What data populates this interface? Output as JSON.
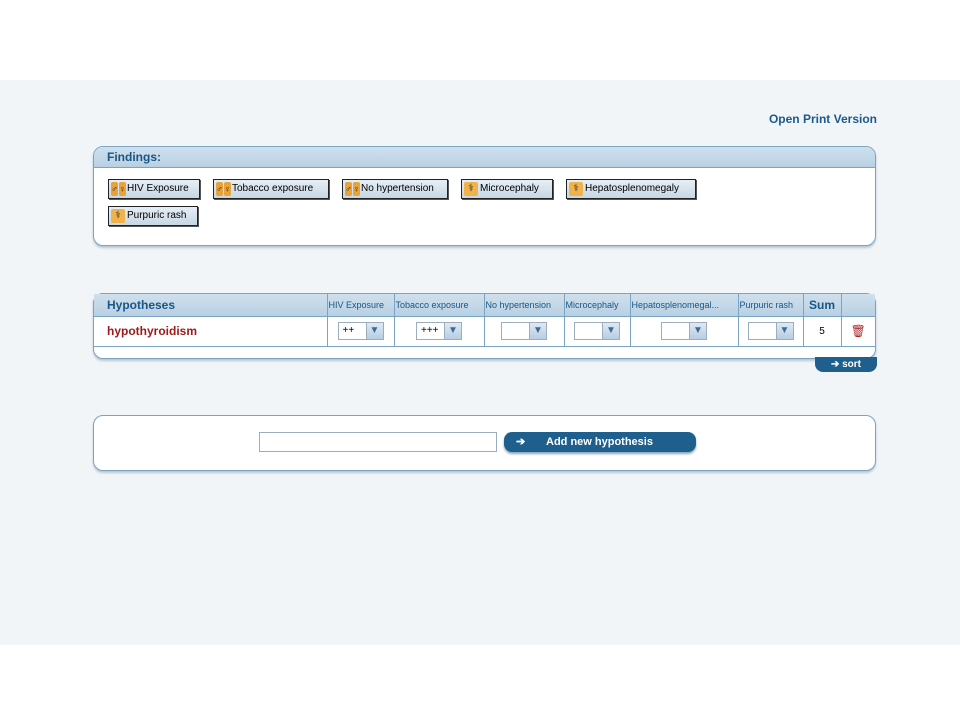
{
  "header": {
    "print_link": "Open Print Version"
  },
  "findings": {
    "title": "Findings:",
    "chips": [
      {
        "label": "HIV Exposure",
        "icon": "person-icon"
      },
      {
        "label": "Tobacco exposure",
        "icon": "person-icon"
      },
      {
        "label": "No hypertension",
        "icon": "person-icon"
      },
      {
        "label": "Microcephaly",
        "icon": "stethoscope-icon"
      },
      {
        "label": "Hepatosplenomegaly",
        "icon": "stethoscope-icon"
      },
      {
        "label": "Purpuric rash",
        "icon": "stethoscope-icon"
      }
    ]
  },
  "hypotheses": {
    "title": "Hypotheses",
    "columns": [
      "HIV Exposure",
      "Tobacco exposure",
      "No hypertension",
      "Microcephaly",
      "Hepatosplenomegal...",
      "Purpuric rash"
    ],
    "sum_label": "Sum",
    "rows": [
      {
        "name": "hypothyroidism",
        "values": [
          "++",
          "+++",
          "",
          "",
          "",
          ""
        ],
        "sum": "5"
      }
    ],
    "sort_label": "sort"
  },
  "add": {
    "input_value": "",
    "button_label": "Add new hypothesis"
  },
  "colors": {
    "accent": "#1e5f8e",
    "hypothesis_name": "#9c1a1a",
    "header_bg": "#cfe0ee"
  }
}
